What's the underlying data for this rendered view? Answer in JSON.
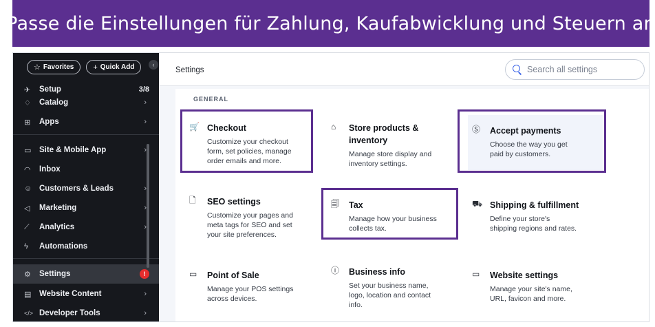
{
  "banner": {
    "text": "Passe die Einstellungen für Zahlung, Kaufabwicklung und Steuern an"
  },
  "sidebar": {
    "favorites_label": "Favorites",
    "quick_add_label": "Quick Add",
    "collapse_glyph": "‹",
    "items": [
      {
        "label": "Setup",
        "icon": "rocket-icon",
        "glyph": "✈",
        "count": "3/8"
      },
      {
        "label": "Catalog",
        "icon": "catalog-icon",
        "glyph": "♢",
        "chevron": "›"
      },
      {
        "label": "Apps",
        "icon": "apps-icon",
        "glyph": "⊞",
        "chevron": "›"
      },
      {
        "label": "Site & Mobile App",
        "icon": "site-icon",
        "glyph": "▭",
        "chevron": "›"
      },
      {
        "label": "Inbox",
        "icon": "inbox-icon",
        "glyph": "◠"
      },
      {
        "label": "Customers & Leads",
        "icon": "customers-icon",
        "glyph": "☺",
        "chevron": "›"
      },
      {
        "label": "Marketing",
        "icon": "marketing-icon",
        "glyph": "◁",
        "chevron": "›"
      },
      {
        "label": "Analytics",
        "icon": "analytics-icon",
        "glyph": "⟋",
        "chevron": "›"
      },
      {
        "label": "Automations",
        "icon": "automations-icon",
        "glyph": "ϟ"
      },
      {
        "label": "Settings",
        "icon": "gear-icon",
        "glyph": "⚙",
        "badge": "!"
      },
      {
        "label": "Website Content",
        "icon": "website-content-icon",
        "glyph": "▤",
        "chevron": "›"
      },
      {
        "label": "Developer Tools",
        "icon": "code-icon",
        "glyph": "</>",
        "chevron": "›"
      }
    ]
  },
  "header": {
    "title": "Settings",
    "search_placeholder": "Search all settings"
  },
  "main": {
    "section_label": "GENERAL",
    "tiles": [
      {
        "title": "Checkout",
        "icon": "cart-icon",
        "glyph": "🛒",
        "desc_lines": [
          "Customize your checkout",
          "form, set policies, manage",
          "order emails and more."
        ]
      },
      {
        "title_lines": [
          "Store products &",
          "inventory"
        ],
        "icon": "store-icon",
        "glyph": "⌂",
        "desc_lines": [
          "Manage store display and",
          "inventory settings."
        ]
      },
      {
        "title": "Accept payments",
        "icon": "payment-icon",
        "glyph": "Ⓢ",
        "desc_lines": [
          "Choose the way you get",
          "paid by customers."
        ]
      },
      {
        "title": "SEO settings",
        "icon": "seo-icon",
        "glyph": "🗋",
        "desc_lines": [
          "Customize your pages and",
          "meta tags for SEO and set",
          "your site preferences."
        ]
      },
      {
        "title": "Tax",
        "icon": "tax-icon",
        "glyph": "🗐",
        "desc_lines": [
          "Manage how your business",
          "collects tax."
        ]
      },
      {
        "title": "Shipping & fulfillment",
        "icon": "truck-icon",
        "glyph": "⛟",
        "desc_lines": [
          "Define your store's",
          "shipping regions and rates."
        ]
      },
      {
        "title": "Point of Sale",
        "icon": "pos-icon",
        "glyph": "▭",
        "desc_lines": [
          "Manage your POS settings",
          "across devices."
        ]
      },
      {
        "title": "Business info",
        "icon": "info-icon",
        "glyph": "ⓘ",
        "desc_lines": [
          "Set your business name,",
          "logo, location and contact",
          "info."
        ]
      },
      {
        "title": "Website settings",
        "icon": "browser-icon",
        "glyph": "▭",
        "desc_lines": [
          "Manage your site's name,",
          "URL, favicon and more."
        ]
      }
    ]
  },
  "colors": {
    "banner": "#5b2f90",
    "sidebar": "#16181d",
    "highlight": "#5b2f90",
    "accent": "#3f67e8",
    "alert": "#e62e2e"
  }
}
